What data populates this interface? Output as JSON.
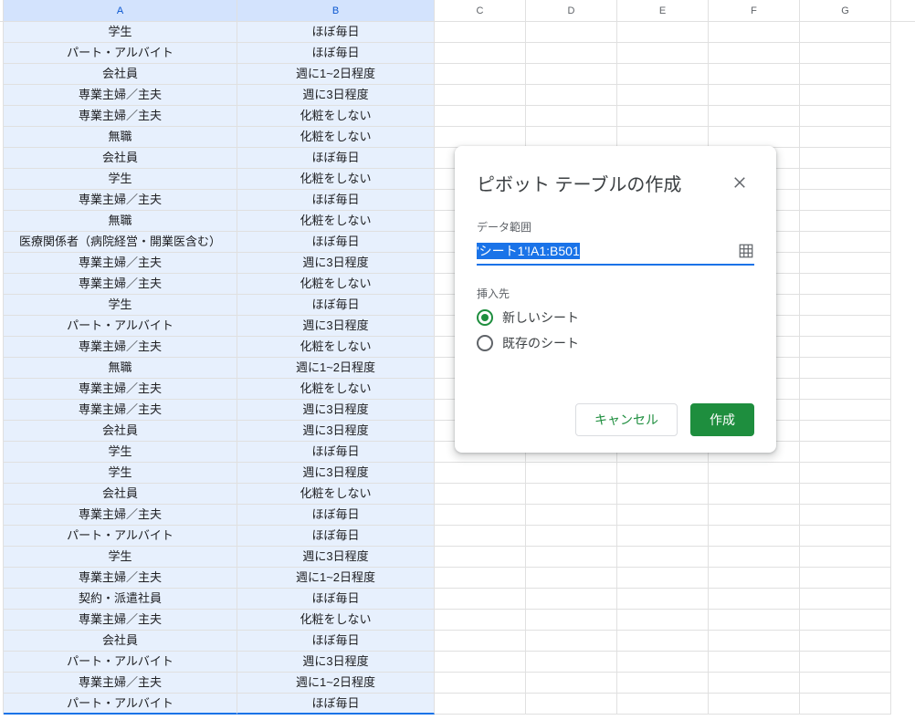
{
  "columns": [
    "A",
    "B",
    "C",
    "D",
    "E",
    "F",
    "G"
  ],
  "rows": [
    {
      "a": "学生",
      "b": "ほぼ毎日"
    },
    {
      "a": "パート・アルバイト",
      "b": "ほぼ毎日"
    },
    {
      "a": "会社員",
      "b": "週に1~2日程度"
    },
    {
      "a": "専業主婦／主夫",
      "b": "週に3日程度"
    },
    {
      "a": "専業主婦／主夫",
      "b": "化粧をしない"
    },
    {
      "a": "無職",
      "b": "化粧をしない"
    },
    {
      "a": "会社員",
      "b": "ほぼ毎日"
    },
    {
      "a": "学生",
      "b": "化粧をしない"
    },
    {
      "a": "専業主婦／主夫",
      "b": "ほぼ毎日"
    },
    {
      "a": "無職",
      "b": "化粧をしない"
    },
    {
      "a": "医療関係者（病院経営・開業医含む）",
      "b": "ほぼ毎日"
    },
    {
      "a": "専業主婦／主夫",
      "b": "週に3日程度"
    },
    {
      "a": "専業主婦／主夫",
      "b": "化粧をしない"
    },
    {
      "a": "学生",
      "b": "ほぼ毎日"
    },
    {
      "a": "パート・アルバイト",
      "b": "週に3日程度"
    },
    {
      "a": "専業主婦／主夫",
      "b": "化粧をしない"
    },
    {
      "a": "無職",
      "b": "週に1~2日程度"
    },
    {
      "a": "専業主婦／主夫",
      "b": "化粧をしない"
    },
    {
      "a": "専業主婦／主夫",
      "b": "週に3日程度"
    },
    {
      "a": "会社員",
      "b": "週に3日程度"
    },
    {
      "a": "学生",
      "b": "ほぼ毎日"
    },
    {
      "a": "学生",
      "b": "週に3日程度"
    },
    {
      "a": "会社員",
      "b": "化粧をしない"
    },
    {
      "a": "専業主婦／主夫",
      "b": "ほぼ毎日"
    },
    {
      "a": "パート・アルバイト",
      "b": "ほぼ毎日"
    },
    {
      "a": "学生",
      "b": "週に3日程度"
    },
    {
      "a": "専業主婦／主夫",
      "b": "週に1~2日程度"
    },
    {
      "a": "契約・派遣社員",
      "b": "ほぼ毎日"
    },
    {
      "a": "専業主婦／主夫",
      "b": "化粧をしない"
    },
    {
      "a": "会社員",
      "b": "ほぼ毎日"
    },
    {
      "a": "パート・アルバイト",
      "b": "週に3日程度"
    },
    {
      "a": "専業主婦／主夫",
      "b": "週に1~2日程度"
    },
    {
      "a": "パート・アルバイト",
      "b": "ほぼ毎日"
    }
  ],
  "dialog": {
    "title": "ピボット テーブルの作成",
    "range_label": "データ範囲",
    "range_value": "'シート1'!A1:B501",
    "insert_label": "挿入先",
    "option_new": "新しいシート",
    "option_existing": "既存のシート",
    "cancel": "キャンセル",
    "create": "作成"
  }
}
